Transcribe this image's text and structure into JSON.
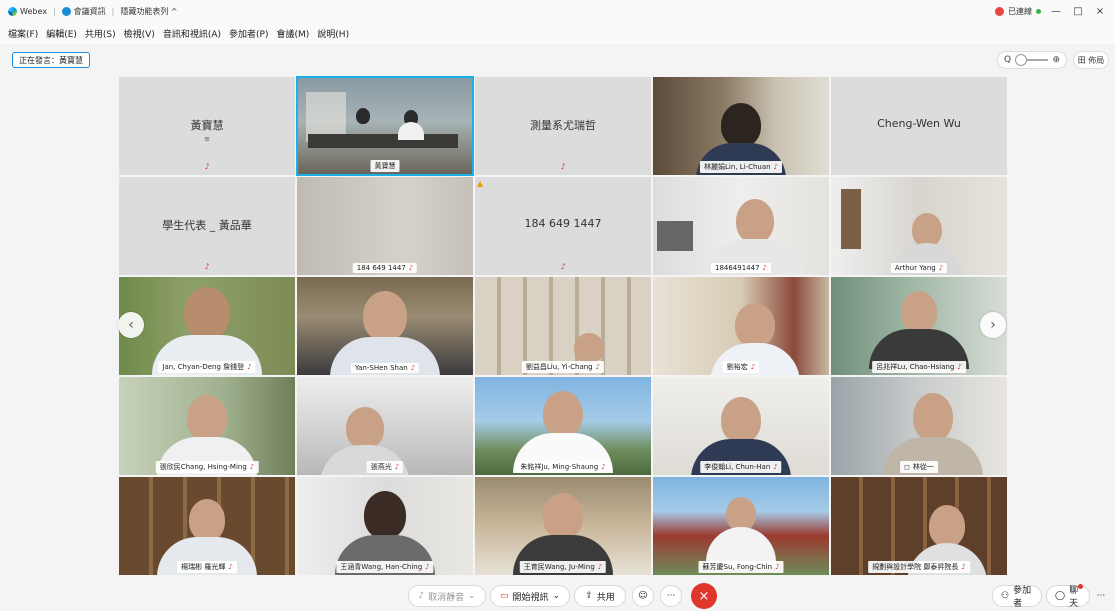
{
  "titlebar": {
    "app_name": "Webex",
    "meeting_info": "會議資訊",
    "hide_menu": "隱藏功能表列 ^",
    "connection": "已連線",
    "minimize": "—",
    "restore": "□",
    "close": "×"
  },
  "menubar": {
    "items": [
      "檔案(F)",
      "編輯(E)",
      "共用(S)",
      "檢視(V)",
      "音訊和視訊(A)",
      "參加者(P)",
      "會議(M)",
      "說明(H)"
    ]
  },
  "speaker_label": "正在發言：黃寶慧",
  "zoom": {
    "minus": "Q",
    "plus": "⊕"
  },
  "layout_button": "田 佈局",
  "tiles": [
    {
      "type": "text",
      "text": "黃寶慧",
      "sub": "≡"
    },
    {
      "type": "video",
      "label": "黃寶慧",
      "active": true
    },
    {
      "type": "text",
      "text": "測量系尤瑞哲"
    },
    {
      "type": "video",
      "label": "林麗娟Lin, Li-Chuan"
    },
    {
      "type": "text",
      "text": "Cheng-Wen Wu"
    },
    {
      "type": "text",
      "text": "學生代表 _ 黃品華"
    },
    {
      "type": "video",
      "label": "184 649 1447"
    },
    {
      "type": "text",
      "text": "184 649 1447",
      "warn": true
    },
    {
      "type": "video",
      "label": "1846491447"
    },
    {
      "type": "video",
      "label": "Arthur Yang"
    },
    {
      "type": "video",
      "label": "Jan, Chyan-Deng 詹錢登"
    },
    {
      "type": "video",
      "label": "Yan-SHen Shan"
    },
    {
      "type": "video",
      "label": "劉益昌Liu, Yi-Chang"
    },
    {
      "type": "video",
      "label": "劉裕宏"
    },
    {
      "type": "video",
      "label": "呂兆祥Lu, Chao-Hsiang"
    },
    {
      "type": "video",
      "label": "張欣民Chang, Hsing-Ming"
    },
    {
      "type": "video",
      "label": "張燕光"
    },
    {
      "type": "video",
      "label": "朱銘祥Ju, Ming-Shaung"
    },
    {
      "type": "video",
      "label": "李俊翰Li, Chun-Han"
    },
    {
      "type": "video",
      "label": "林從一"
    },
    {
      "type": "video",
      "label": "楊瑞彬 羅光輝"
    },
    {
      "type": "video",
      "label": "王涵青Wang, Han-Ching"
    },
    {
      "type": "video",
      "label": "王育民Wang, Ju-Ming"
    },
    {
      "type": "video",
      "label": "蘇芳慶Su, Fong-Chin"
    },
    {
      "type": "video",
      "label": "規劃與設計學院 鄭泰昇院長"
    }
  ],
  "bottombar": {
    "unmute": "取消靜音",
    "start_video": "開始視訊",
    "share": "共用",
    "more": "···",
    "end": "×",
    "participants": "參加者",
    "chat": "聊天"
  },
  "colors": {
    "accent": "#1ab0e8",
    "end_call": "#e0352b",
    "mic_muted": "#d13a3a"
  }
}
